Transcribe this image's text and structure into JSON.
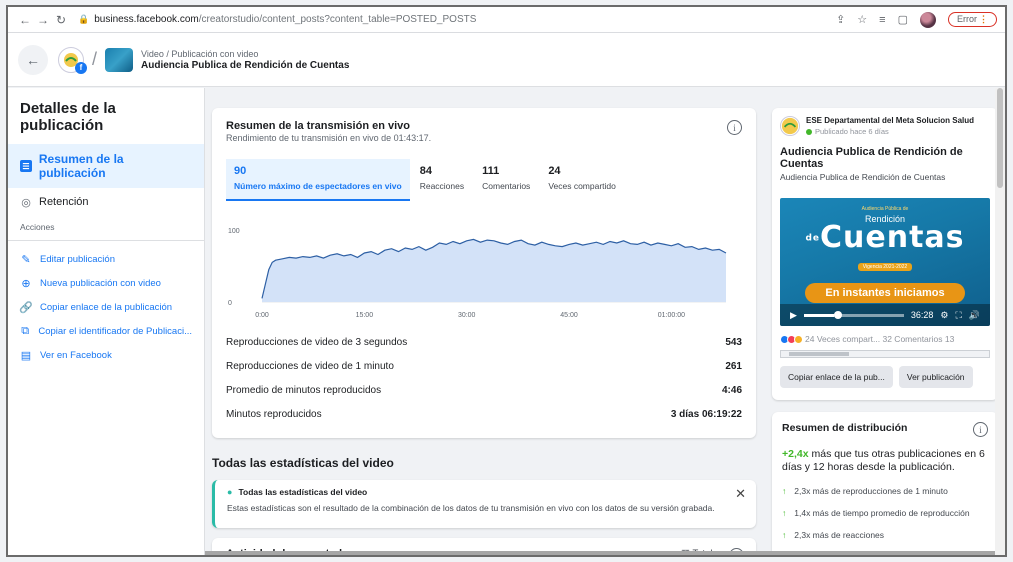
{
  "browser": {
    "url_host": "business.facebook.com",
    "url_path": "/creatorstudio/content_posts?content_table=POSTED_POSTS",
    "error_label": "Error"
  },
  "header": {
    "breadcrumb": "Video / Publicación con video",
    "title": "Audiencia Publica de Rendición de Cuentas"
  },
  "sidebar": {
    "title": "Detalles de la publicación",
    "items": [
      {
        "label": "Resumen de la publicación"
      },
      {
        "label": "Retención"
      }
    ],
    "section_label": "Acciones",
    "actions": [
      {
        "label": "Editar publicación"
      },
      {
        "label": "Nueva publicación con video"
      },
      {
        "label": "Copiar enlace de la publicación"
      },
      {
        "label": "Copiar el identificador de Publicaci..."
      },
      {
        "label": "Ver en Facebook"
      }
    ]
  },
  "live": {
    "title": "Resumen de la transmisión en vivo",
    "subtitle": "Rendimiento de tu transmisión en vivo de 01:43:17.",
    "metrics": [
      {
        "value": "90",
        "label": "Número máximo de espectadores en vivo"
      },
      {
        "value": "84",
        "label": "Reacciones"
      },
      {
        "value": "111",
        "label": "Comentarios"
      },
      {
        "value": "24",
        "label": "Veces compartido"
      }
    ],
    "stats": [
      {
        "label": "Reproducciones de video de 3 segundos",
        "value": "543"
      },
      {
        "label": "Reproducciones de video de 1 minuto",
        "value": "261"
      },
      {
        "label": "Promedio de minutos reproducidos",
        "value": "4:46"
      },
      {
        "label": "Minutos reproducidos",
        "value": "3 días 06:19:22"
      }
    ]
  },
  "chart_data": {
    "type": "area",
    "ylim": [
      0,
      100
    ],
    "y_ticks": [
      "100",
      "0"
    ],
    "x_ticks": [
      "0:00",
      "15:00",
      "30:00",
      "45:00",
      "01:00:00"
    ],
    "x": [
      0,
      0.5,
      1,
      1.5,
      2,
      3,
      4,
      5,
      6,
      7,
      8,
      9,
      10,
      11,
      12,
      13,
      14,
      15,
      16,
      17,
      18,
      19,
      20,
      21,
      22,
      23,
      24,
      25,
      26,
      27,
      28,
      29,
      30,
      31,
      32,
      33,
      34,
      35,
      36,
      37,
      38,
      39,
      40,
      41,
      42,
      43,
      44,
      45,
      46,
      47,
      48,
      49,
      50,
      51,
      52,
      53,
      54,
      55,
      56,
      57,
      58,
      59,
      60,
      61,
      62,
      63,
      64,
      65,
      66,
      67,
      68
    ],
    "values": [
      5,
      25,
      45,
      55,
      58,
      60,
      62,
      61,
      63,
      62,
      64,
      61,
      65,
      67,
      64,
      66,
      62,
      68,
      70,
      66,
      72,
      74,
      70,
      75,
      73,
      77,
      72,
      76,
      82,
      80,
      84,
      81,
      85,
      87,
      83,
      86,
      85,
      82,
      80,
      84,
      86,
      81,
      79,
      83,
      80,
      78,
      77,
      80,
      82,
      79,
      81,
      83,
      80,
      84,
      82,
      85,
      81,
      80,
      83,
      79,
      82,
      80,
      78,
      81,
      76,
      77,
      73,
      75,
      72,
      73,
      68
    ]
  },
  "all_stats": {
    "section_title": "Todas las estadísticas del video",
    "notice_title": "Todas las estadísticas del video",
    "notice_body": "Estas estadísticas son el resultado de la combinación de los datos de tu transmisión en vivo con los datos de su versión grabada.",
    "activity_title": "Actividad de espectadores",
    "total_label": "Total"
  },
  "post": {
    "page_name": "ESE Departamental del Meta Solucion Salud Public...",
    "published": "Publicado hace 6 días",
    "title": "Audiencia Publica de Rendición de Cuentas",
    "description": "Audiencia Publica de Rendición de Cuentas",
    "video": {
      "top_text": "Audiencia Pública de",
      "main_text": "Cuentas",
      "small_text": "Rendición",
      "de_text": "de",
      "period": "Vigencia 2021-2022",
      "cta": "En instantes iniciamos",
      "time": "36:28",
      "progress": 0.3
    },
    "stats_text": "24 Veces compart...  32 Comentarios 13",
    "copy_link": "Copiar enlace de la pub...",
    "view_post": "Ver publicación"
  },
  "distribution": {
    "title": "Resumen de distribución",
    "lead_bold": "+2,4x",
    "lead_rest": " más que tus otras publicaciones en 6 días y 12 horas desde la publicación.",
    "items": [
      {
        "text": "2,3x más de reproducciones de 1 minuto"
      },
      {
        "text": "1,4x más de tiempo promedio de reproducción"
      },
      {
        "text": "2,3x más de reacciones"
      }
    ]
  },
  "colors": {
    "accent": "#1877f2",
    "positive": "#42b72a",
    "chart_fill": "#d3e2f8",
    "chart_line": "#2d5fa4"
  }
}
